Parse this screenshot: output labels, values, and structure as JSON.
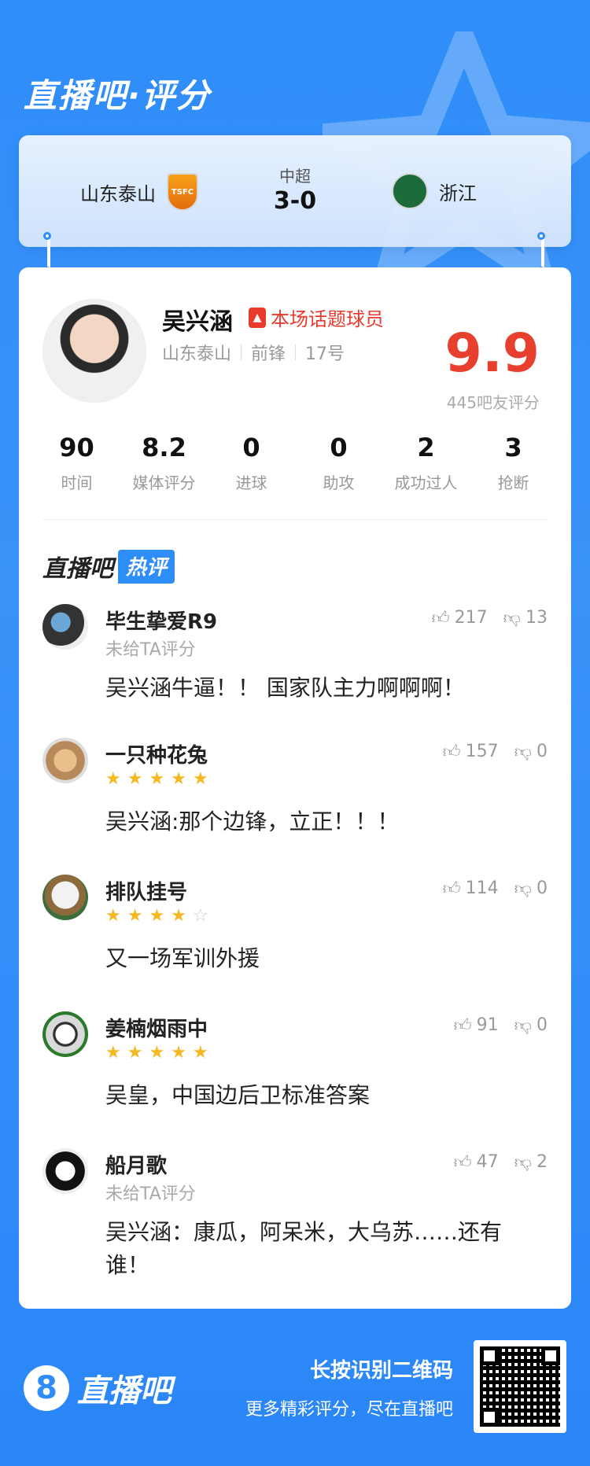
{
  "brand": {
    "title": "直播吧·评分"
  },
  "match": {
    "league": "中超",
    "score": "3-0",
    "home_team": "山东泰山",
    "away_team": "浙江"
  },
  "player": {
    "name": "吴兴涵",
    "badge": "本场话题球员",
    "team": "山东泰山",
    "position": "前锋",
    "number": "17号",
    "rating": "9.9",
    "rating_count": "445吧友评分"
  },
  "stats": [
    {
      "value": "90",
      "label": "时间"
    },
    {
      "value": "8.2",
      "label": "媒体评分"
    },
    {
      "value": "0",
      "label": "进球"
    },
    {
      "value": "0",
      "label": "助攻"
    },
    {
      "value": "2",
      "label": "成功过人"
    },
    {
      "value": "3",
      "label": "抢断"
    }
  ],
  "hot_comments": {
    "title_a": "直播吧",
    "title_b": "热评",
    "items": [
      {
        "name": "毕生挚爱R9",
        "sub": "未给TA评分",
        "stars": null,
        "likes": "217",
        "dislikes": "13",
        "text": "吴兴涵牛逼！！ 国家队主力啊啊啊！"
      },
      {
        "name": "一只种花兔",
        "sub": null,
        "stars": 5,
        "likes": "157",
        "dislikes": "0",
        "text": "吴兴涵:那个边锋，立正！！！"
      },
      {
        "name": "排队挂号",
        "sub": null,
        "stars": 4,
        "likes": "114",
        "dislikes": "0",
        "text": "又一场军训外援"
      },
      {
        "name": "姜楠烟雨中",
        "sub": null,
        "stars": 5,
        "likes": "91",
        "dislikes": "0",
        "text": "吴皇，中国边后卫标准答案"
      },
      {
        "name": "船月歌",
        "sub": "未给TA评分",
        "stars": null,
        "likes": "47",
        "dislikes": "2",
        "text": "吴兴涵：康瓜，阿呆米，大乌苏……还有谁！"
      }
    ]
  },
  "footer": {
    "logo_text": "直播吧",
    "logo_glyph": "8",
    "qr_title": "长按识别二维码",
    "qr_sub": "更多精彩评分，尽在直播吧"
  },
  "colors": {
    "accent": "#2f8df8",
    "rating": "#e8402f",
    "star": "#f6b820"
  }
}
